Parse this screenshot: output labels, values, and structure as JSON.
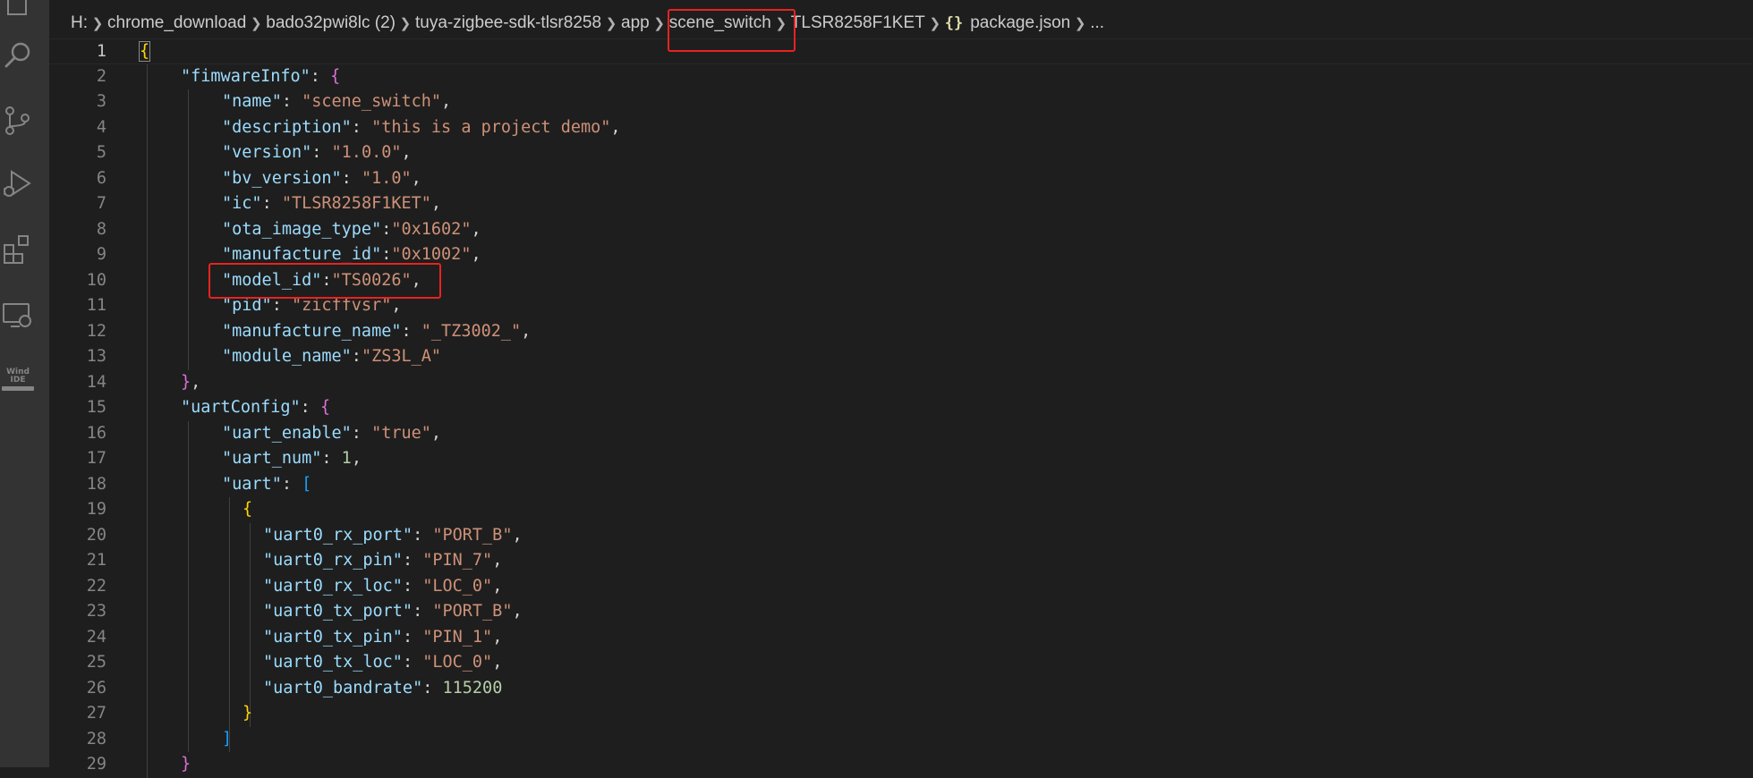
{
  "activity_bar": {
    "icons": [
      "files-icon",
      "search-icon",
      "source-control-icon",
      "run-debug-icon",
      "extensions-icon",
      "remote-explorer-icon",
      "wind-ide-icon"
    ],
    "wind_ide_label_line1": "Wind",
    "wind_ide_label_line2": "IDE"
  },
  "breadcrumb": {
    "items": [
      "H:",
      "chrome_download",
      "bado32pwi8lc (2)",
      "tuya-zigbee-sdk-tlsr8258",
      "app",
      "scene_switch",
      "TLSR8258F1KET",
      "package.json",
      "..."
    ],
    "file_icon": "{}"
  },
  "editor": {
    "current_line": 1,
    "lines": [
      {
        "num": "1",
        "indent": 0,
        "tokens": [
          {
            "t": "{",
            "c": "b1 cursor-brace"
          }
        ]
      },
      {
        "num": "2",
        "indent": 1,
        "tokens": [
          {
            "t": "\"fimwareInfo\"",
            "c": "k"
          },
          {
            "t": ": ",
            "c": "p"
          },
          {
            "t": "{",
            "c": "b2"
          }
        ]
      },
      {
        "num": "3",
        "indent": 2,
        "tokens": [
          {
            "t": "\"name\"",
            "c": "k"
          },
          {
            "t": ": ",
            "c": "p"
          },
          {
            "t": "\"scene_switch\"",
            "c": "s"
          },
          {
            "t": ",",
            "c": "p"
          }
        ]
      },
      {
        "num": "4",
        "indent": 2,
        "tokens": [
          {
            "t": "\"description\"",
            "c": "k"
          },
          {
            "t": ": ",
            "c": "p"
          },
          {
            "t": "\"this is a project demo\"",
            "c": "s"
          },
          {
            "t": ",",
            "c": "p"
          }
        ]
      },
      {
        "num": "5",
        "indent": 2,
        "tokens": [
          {
            "t": "\"version\"",
            "c": "k"
          },
          {
            "t": ": ",
            "c": "p"
          },
          {
            "t": "\"1.0.0\"",
            "c": "s"
          },
          {
            "t": ",",
            "c": "p"
          }
        ]
      },
      {
        "num": "6",
        "indent": 2,
        "tokens": [
          {
            "t": "\"bv_version\"",
            "c": "k"
          },
          {
            "t": ": ",
            "c": "p"
          },
          {
            "t": "\"1.0\"",
            "c": "s"
          },
          {
            "t": ",",
            "c": "p"
          }
        ]
      },
      {
        "num": "7",
        "indent": 2,
        "tokens": [
          {
            "t": "\"ic\"",
            "c": "k"
          },
          {
            "t": ": ",
            "c": "p"
          },
          {
            "t": "\"TLSR8258F1KET\"",
            "c": "s"
          },
          {
            "t": ",",
            "c": "p"
          }
        ]
      },
      {
        "num": "8",
        "indent": 2,
        "tokens": [
          {
            "t": "\"ota_image_type\"",
            "c": "k"
          },
          {
            "t": ":",
            "c": "p"
          },
          {
            "t": "\"0x1602\"",
            "c": "s"
          },
          {
            "t": ",",
            "c": "p"
          }
        ]
      },
      {
        "num": "9",
        "indent": 2,
        "tokens": [
          {
            "t": "\"manufacture_id\"",
            "c": "k"
          },
          {
            "t": ":",
            "c": "p"
          },
          {
            "t": "\"0x1002\"",
            "c": "s"
          },
          {
            "t": ",",
            "c": "p"
          }
        ]
      },
      {
        "num": "10",
        "indent": 2,
        "tokens": [
          {
            "t": "\"model_id\"",
            "c": "k"
          },
          {
            "t": ":",
            "c": "p"
          },
          {
            "t": "\"TS0026\"",
            "c": "s"
          },
          {
            "t": ",",
            "c": "p"
          }
        ]
      },
      {
        "num": "11",
        "indent": 2,
        "tokens": [
          {
            "t": "\"pid\"",
            "c": "k"
          },
          {
            "t": ": ",
            "c": "p"
          },
          {
            "t": "\"zicffvsr\"",
            "c": "s"
          },
          {
            "t": ",",
            "c": "p"
          }
        ]
      },
      {
        "num": "12",
        "indent": 2,
        "tokens": [
          {
            "t": "\"manufacture_name\"",
            "c": "k"
          },
          {
            "t": ": ",
            "c": "p"
          },
          {
            "t": "\"_TZ3002_\"",
            "c": "s"
          },
          {
            "t": ",",
            "c": "p"
          }
        ]
      },
      {
        "num": "13",
        "indent": 2,
        "tokens": [
          {
            "t": "\"module_name\"",
            "c": "k"
          },
          {
            "t": ":",
            "c": "p"
          },
          {
            "t": "\"ZS3L_A\"",
            "c": "s"
          }
        ]
      },
      {
        "num": "14",
        "indent": 1,
        "tokens": [
          {
            "t": "}",
            "c": "b2"
          },
          {
            "t": ",",
            "c": "p"
          }
        ]
      },
      {
        "num": "15",
        "indent": 1,
        "tokens": [
          {
            "t": "\"uartConfig\"",
            "c": "k"
          },
          {
            "t": ": ",
            "c": "p"
          },
          {
            "t": "{",
            "c": "b2"
          }
        ]
      },
      {
        "num": "16",
        "indent": 2,
        "tokens": [
          {
            "t": "\"uart_enable\"",
            "c": "k"
          },
          {
            "t": ": ",
            "c": "p"
          },
          {
            "t": "\"true\"",
            "c": "s"
          },
          {
            "t": ",",
            "c": "p"
          }
        ]
      },
      {
        "num": "17",
        "indent": 2,
        "tokens": [
          {
            "t": "\"uart_num\"",
            "c": "k"
          },
          {
            "t": ": ",
            "c": "p"
          },
          {
            "t": "1",
            "c": "n"
          },
          {
            "t": ",",
            "c": "p"
          }
        ]
      },
      {
        "num": "18",
        "indent": 2,
        "tokens": [
          {
            "t": "\"uart\"",
            "c": "k"
          },
          {
            "t": ": ",
            "c": "p"
          },
          {
            "t": "[",
            "c": "b3"
          }
        ]
      },
      {
        "num": "19",
        "indent": 2.5,
        "tokens": [
          {
            "t": "{",
            "c": "b1"
          }
        ]
      },
      {
        "num": "20",
        "indent": 3,
        "tokens": [
          {
            "t": "\"uart0_rx_port\"",
            "c": "k"
          },
          {
            "t": ": ",
            "c": "p"
          },
          {
            "t": "\"PORT_B\"",
            "c": "s"
          },
          {
            "t": ",",
            "c": "p"
          }
        ]
      },
      {
        "num": "21",
        "indent": 3,
        "tokens": [
          {
            "t": "\"uart0_rx_pin\"",
            "c": "k"
          },
          {
            "t": ": ",
            "c": "p"
          },
          {
            "t": "\"PIN_7\"",
            "c": "s"
          },
          {
            "t": ",",
            "c": "p"
          }
        ]
      },
      {
        "num": "22",
        "indent": 3,
        "tokens": [
          {
            "t": "\"uart0_rx_loc\"",
            "c": "k"
          },
          {
            "t": ": ",
            "c": "p"
          },
          {
            "t": "\"LOC_0\"",
            "c": "s"
          },
          {
            "t": ",",
            "c": "p"
          }
        ]
      },
      {
        "num": "23",
        "indent": 3,
        "tokens": [
          {
            "t": "\"uart0_tx_port\"",
            "c": "k"
          },
          {
            "t": ": ",
            "c": "p"
          },
          {
            "t": "\"PORT_B\"",
            "c": "s"
          },
          {
            "t": ",",
            "c": "p"
          }
        ]
      },
      {
        "num": "24",
        "indent": 3,
        "tokens": [
          {
            "t": "\"uart0_tx_pin\"",
            "c": "k"
          },
          {
            "t": ": ",
            "c": "p"
          },
          {
            "t": "\"PIN_1\"",
            "c": "s"
          },
          {
            "t": ",",
            "c": "p"
          }
        ]
      },
      {
        "num": "25",
        "indent": 3,
        "tokens": [
          {
            "t": "\"uart0_tx_loc\"",
            "c": "k"
          },
          {
            "t": ": ",
            "c": "p"
          },
          {
            "t": "\"LOC_0\"",
            "c": "s"
          },
          {
            "t": ",",
            "c": "p"
          }
        ]
      },
      {
        "num": "26",
        "indent": 3,
        "tokens": [
          {
            "t": "\"uart0_bandrate\"",
            "c": "k"
          },
          {
            "t": ": ",
            "c": "p"
          },
          {
            "t": "115200",
            "c": "n"
          }
        ]
      },
      {
        "num": "27",
        "indent": 2.5,
        "tokens": [
          {
            "t": "}",
            "c": "b1"
          }
        ]
      },
      {
        "num": "28",
        "indent": 2,
        "tokens": [
          {
            "t": "]",
            "c": "b3"
          }
        ]
      },
      {
        "num": "29",
        "indent": 1,
        "tokens": [
          {
            "t": "}",
            "c": "b2"
          }
        ]
      }
    ]
  },
  "colors": {
    "highlight_box": "#e8231f",
    "background": "#1e1e1e",
    "activity_bar": "#333333"
  }
}
